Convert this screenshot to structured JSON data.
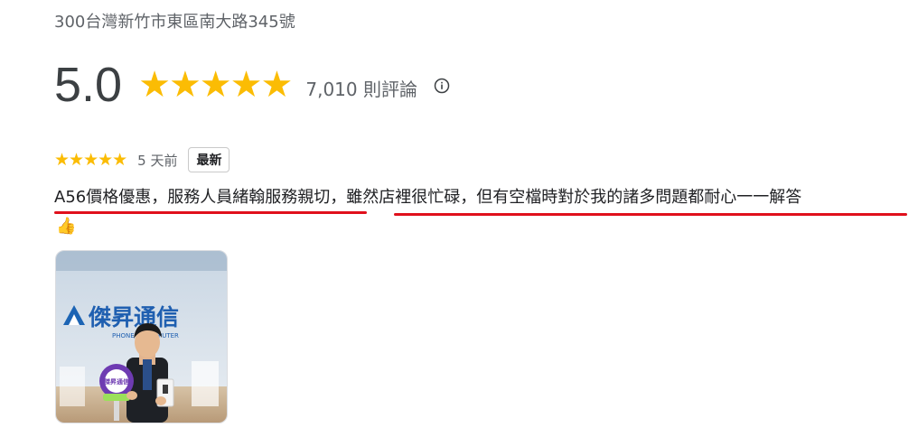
{
  "place": {
    "address": "300台灣新竹市東區南大路345號"
  },
  "rating": {
    "score": "5.0",
    "stars": "★★★★★",
    "review_count": "7,010 則評論"
  },
  "review": {
    "stars": "★★★★★",
    "age": "5 天前",
    "badge": "最新",
    "text": "A56價格優惠，服務人員緒翰服務親切，雖然店裡很忙碌，但有空檔時對於我的諸多問題都耐心一一解答",
    "emoji": "👍",
    "photo": {
      "store_sign": "傑昇通信",
      "sub_sign": "PHONE & COMPUTER",
      "fan_text": "傑昇通信"
    }
  },
  "colors": {
    "star": "#fbbc04",
    "underline": "#e0101c",
    "muted_text": "#5f6368"
  },
  "icons": {
    "info": "info-icon",
    "thumbs_up": "thumbs-up-icon"
  }
}
